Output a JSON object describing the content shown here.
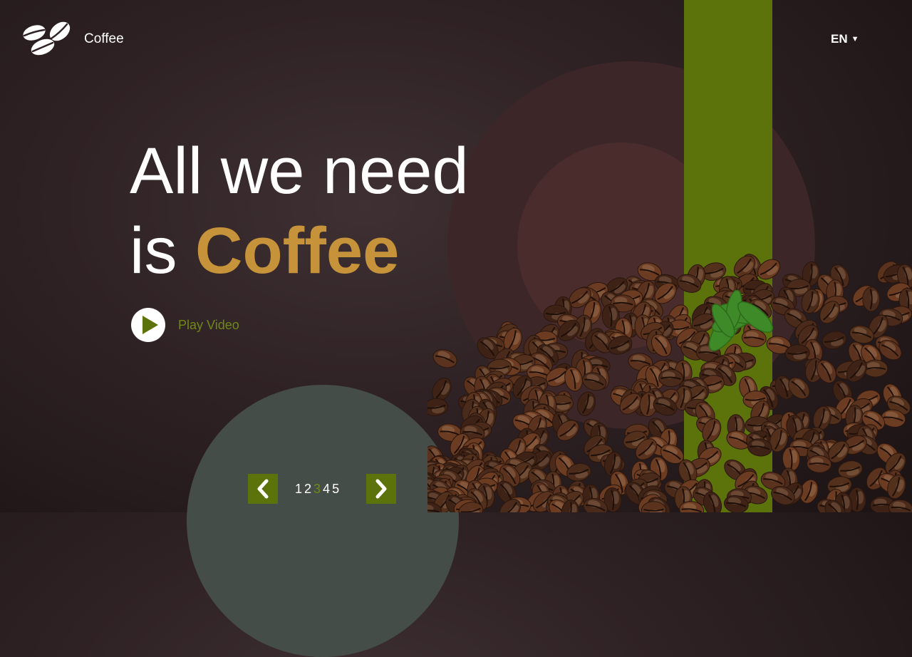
{
  "header": {
    "brand": "Coffee",
    "language": "EN",
    "logo_icon": "coffee-beans-icon"
  },
  "hero": {
    "line1": "All we need",
    "line2_prefix": "is ",
    "line2_accent": "Coffee",
    "play_label": "Play Video"
  },
  "pagination": {
    "pages": [
      "1",
      "2",
      "3",
      "4",
      "5"
    ],
    "active_page": "3",
    "prev_icon": "chevron-left-icon",
    "next_icon": "chevron-right-icon"
  },
  "colors": {
    "background": "#2f2224",
    "accent_gold": "#c7933a",
    "accent_green": "#5c730c",
    "play_text": "#6f8a12",
    "teal_shape": "#454d49"
  }
}
